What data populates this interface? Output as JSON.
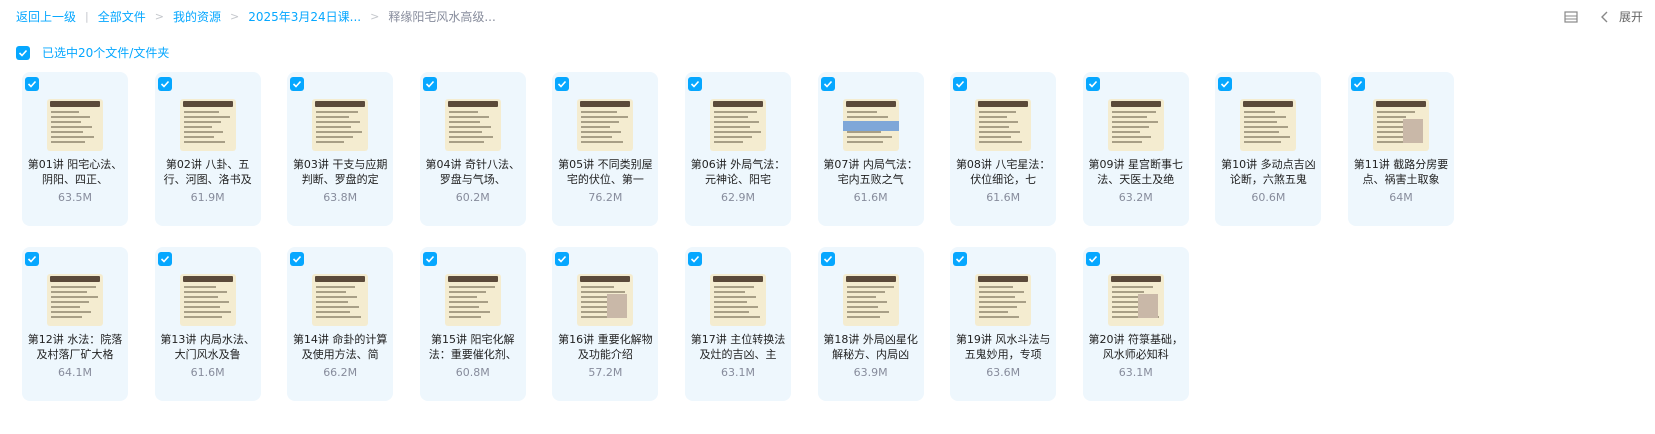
{
  "breadcrumb": {
    "back": "返回上一级",
    "items": [
      "全部文件",
      "我的资源",
      "2025年3月24日课...",
      "释缘阳宅风水高级..."
    ]
  },
  "toolbar": {
    "expand_label": "展开"
  },
  "selection": {
    "label": "已选中20个文件/文件夹"
  },
  "files": [
    {
      "name": "第01讲 阳宅心法、阴阳、四正、",
      "size": "63.5M"
    },
    {
      "name": "第02讲 八卦、五行、河图、洛书及",
      "size": "61.9M"
    },
    {
      "name": "第03讲 干支与应期判断、罗盘的定",
      "size": "63.8M"
    },
    {
      "name": "第04讲 奇针八法、罗盘与气场、",
      "size": "60.2M"
    },
    {
      "name": "第05讲 不同类别屋宅的伏位、第一",
      "size": "76.2M"
    },
    {
      "name": "第06讲 外局气法：元神论、阳宅",
      "size": "62.9M"
    },
    {
      "name": "第07讲 内局气法：宅内五败之气",
      "size": "61.6M"
    },
    {
      "name": "第08讲 八宅星法：伏位细论，七",
      "size": "61.6M"
    },
    {
      "name": "第09讲 星宫断事七法、天医土及绝",
      "size": "63.2M"
    },
    {
      "name": "第10讲 多动点吉凶论断，六煞五鬼",
      "size": "60.6M"
    },
    {
      "name": "第11讲 截路分房要点、祸害土取象",
      "size": "64M"
    },
    {
      "name": "第12讲 水法：院落及村落厂矿大格",
      "size": "64.1M"
    },
    {
      "name": "第13讲 内局水法、大门风水及鲁",
      "size": "61.6M"
    },
    {
      "name": "第14讲 命卦的计算及使用方法、简",
      "size": "66.2M"
    },
    {
      "name": "第15讲 阳宅化解法：重要催化剂、",
      "size": "60.8M"
    },
    {
      "name": "第16讲 重要化解物及功能介绍",
      "size": "57.2M"
    },
    {
      "name": "第17讲 主位转换法及灶的吉凶、主",
      "size": "63.1M"
    },
    {
      "name": "第18讲 外局凶星化解秘方、内局凶",
      "size": "63.9M"
    },
    {
      "name": "第19讲 风水斗法与五鬼妙用，专项",
      "size": "63.6M"
    },
    {
      "name": "第20讲 符箓基础，风水师必知科",
      "size": "63.1M"
    }
  ]
}
